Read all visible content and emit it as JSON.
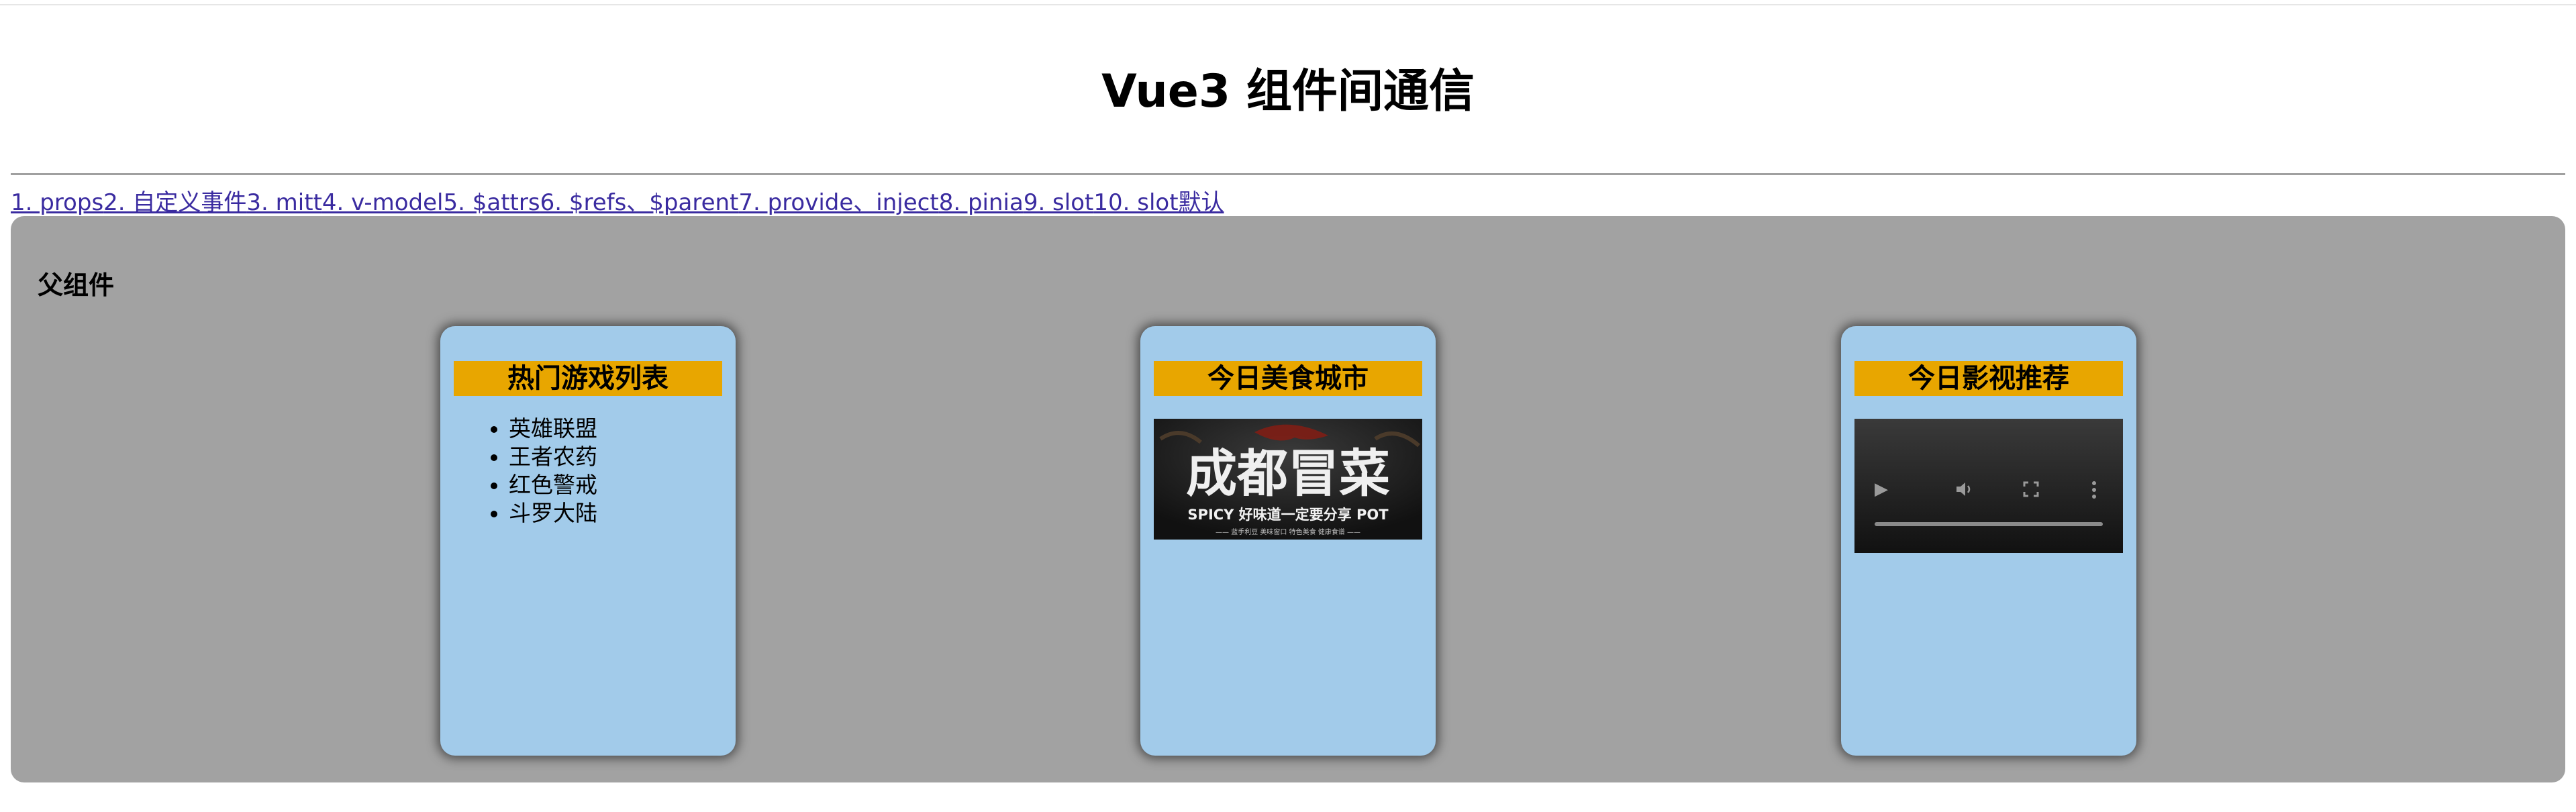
{
  "app": {
    "title": "Vue3 组件间通信"
  },
  "nav": {
    "links": [
      "1. props",
      "2. 自定义事件",
      "3. mitt",
      "4. v-model",
      "5. $attrs",
      "6. $refs、$parent",
      "7. provide、inject",
      "8. pinia",
      "9. slot",
      "10. slot默认"
    ]
  },
  "parent": {
    "label": "父组件"
  },
  "cards": {
    "games": {
      "title": "热门游戏列表",
      "items": [
        "英雄联盟",
        "王者农药",
        "红色警戒",
        "斗罗大陆"
      ]
    },
    "food": {
      "title": "今日美食城市",
      "image": {
        "headline": "成都冒菜",
        "tagline": "SPICY  好味道一定要分享  POT",
        "subline": "—— 蓝手利豆 美味窗口 特色美食 健康食谱 ——"
      }
    },
    "movies": {
      "title": "今日影视推荐"
    }
  },
  "colors": {
    "panel": "#a2a2a2",
    "card": "#a2cbea",
    "card_title": "#e8a600",
    "link": "#3a2ba0"
  },
  "icons": {
    "video_controls": [
      "play-icon",
      "volume-icon",
      "fullscreen-icon",
      "more-icon"
    ]
  }
}
